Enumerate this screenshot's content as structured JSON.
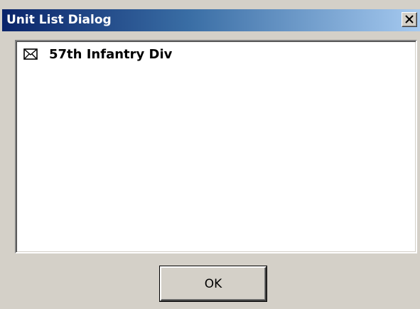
{
  "window": {
    "title": "Unit List Dialog",
    "close_icon": "close-icon"
  },
  "list": {
    "items": [
      {
        "icon": "envelope-icon",
        "label": "57th Infantry Div"
      }
    ]
  },
  "buttons": {
    "ok_label": "OK"
  },
  "colors": {
    "titlebar_start": "#0a246a",
    "titlebar_end": "#a6caf0",
    "face": "#d4d0c8"
  }
}
